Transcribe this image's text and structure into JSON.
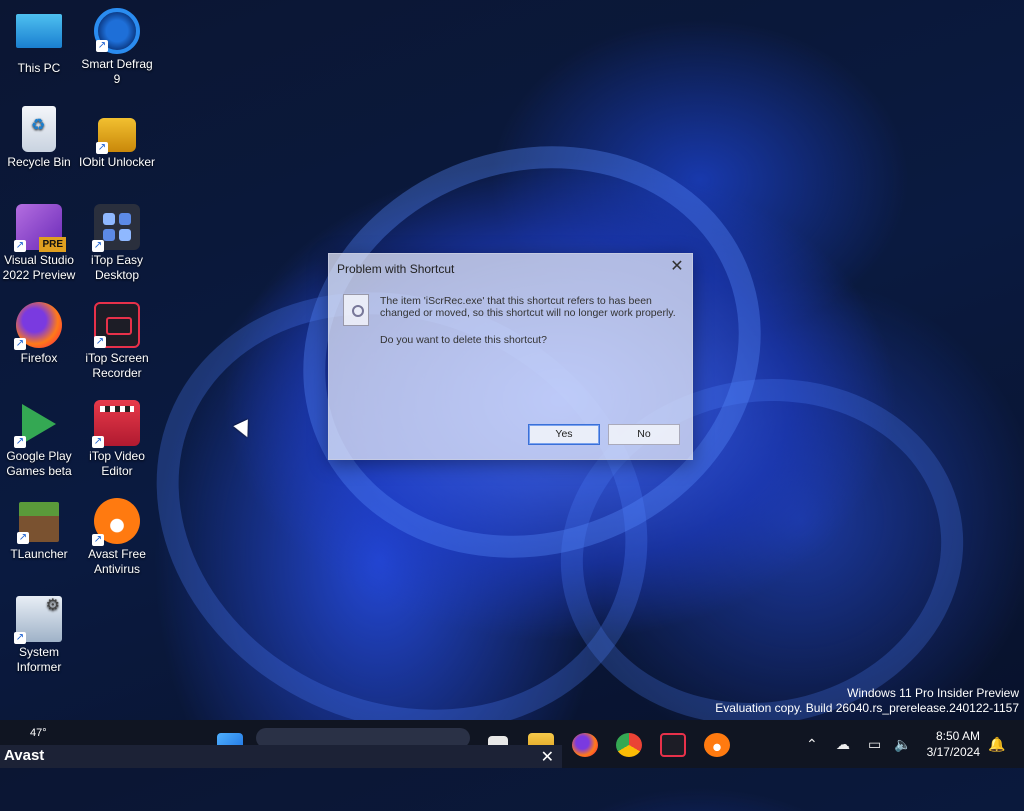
{
  "desktop_icons": [
    {
      "id": "this-pc",
      "label": "This PC"
    },
    {
      "id": "smart-defrag",
      "label": "Smart Defrag 9"
    },
    {
      "id": "recycle-bin",
      "label": "Recycle Bin"
    },
    {
      "id": "iobit-unlocker",
      "label": "IObit Unlocker"
    },
    {
      "id": "visual-studio",
      "label": "Visual Studio 2022 Preview",
      "badge": "PRE"
    },
    {
      "id": "itop-easy-desktop",
      "label": "iTop Easy Desktop"
    },
    {
      "id": "firefox",
      "label": "Firefox"
    },
    {
      "id": "itop-screen-recorder",
      "label": "iTop Screen Recorder"
    },
    {
      "id": "google-play-games",
      "label": "Google Play Games beta"
    },
    {
      "id": "itop-video-editor",
      "label": "iTop Video Editor"
    },
    {
      "id": "tlauncher",
      "label": "TLauncher"
    },
    {
      "id": "avast-free",
      "label": "Avast Free Antivirus"
    },
    {
      "id": "system-informer",
      "label": "System Informer"
    }
  ],
  "dialog": {
    "title": "Problem with Shortcut",
    "close_glyph": "✕",
    "message": "The item 'iScrRec.exe' that this shortcut refers to has been changed or moved, so this shortcut will no longer work properly.",
    "question": "Do you want to delete this shortcut?",
    "yes_label": "Yes",
    "no_label": "No"
  },
  "watermark": {
    "line1": "Windows 11 Pro Insider Preview",
    "line2": "Evaluation copy. Build 26040.rs_prerelease.240122-1157"
  },
  "taskbar": {
    "weather": "47°",
    "pinned": [
      "windows-start-icon",
      "file-explorer-icon",
      "firefox-icon",
      "chrome-icon",
      "itop-screen-recorder-icon",
      "avast-icon"
    ],
    "tray": {
      "time": "8:50 AM",
      "date": "3/17/2024"
    }
  },
  "avast_popup": {
    "brand": "Avast",
    "close_glyph": "✕"
  }
}
